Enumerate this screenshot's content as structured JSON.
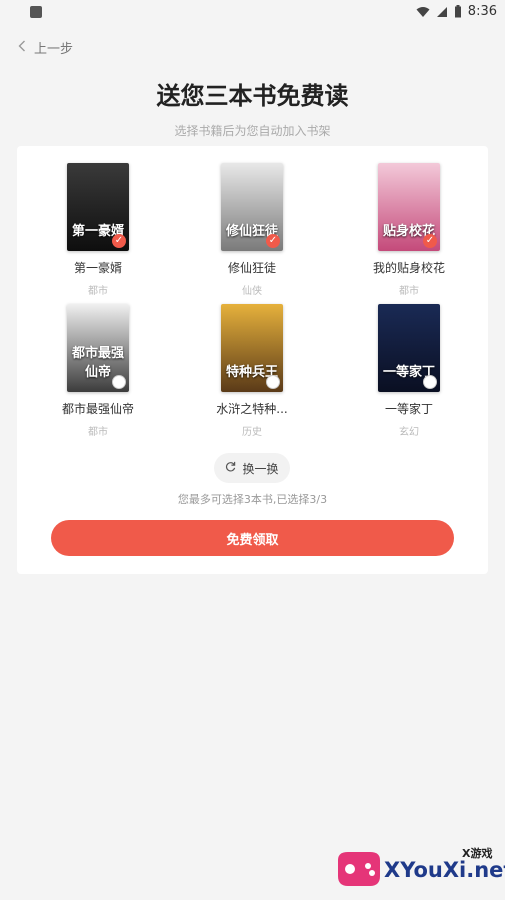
{
  "status_bar": {
    "time": "8:36"
  },
  "nav": {
    "back_label": "上一步"
  },
  "header": {
    "title": "送您三本书免费读",
    "subtitle": "选择书籍后为您自动加入书架"
  },
  "books": [
    {
      "name": "第一豪婿",
      "genre": "都市",
      "cover_text": "第一豪婿",
      "selected": true,
      "cover_colors": [
        "#3a3a3a",
        "#0e0e0e"
      ]
    },
    {
      "name": "修仙狂徒",
      "genre": "仙侠",
      "cover_text": "修仙狂徒",
      "selected": true,
      "cover_colors": [
        "#e8e8e8",
        "#7a7a7a"
      ]
    },
    {
      "name": "我的贴身校花",
      "genre": "都市",
      "cover_text": "贴身校花",
      "selected": true,
      "cover_colors": [
        "#f3c9d9",
        "#c44a7a"
      ]
    },
    {
      "name": "都市最强仙帝",
      "genre": "都市",
      "cover_text": "都市最强仙帝",
      "selected": false,
      "cover_colors": [
        "#f0f0f0",
        "#3c3c3c"
      ]
    },
    {
      "name": "水浒之特种...",
      "genre": "历史",
      "cover_text": "特种兵王",
      "selected": false,
      "cover_colors": [
        "#e6b13c",
        "#5a3a18"
      ]
    },
    {
      "name": "一等家丁",
      "genre": "玄幻",
      "cover_text": "一等家丁",
      "selected": false,
      "cover_colors": [
        "#1a2a55",
        "#0a0f22"
      ]
    }
  ],
  "actions": {
    "swap_label": "换一换",
    "hint": "您最多可选择3本书,已选择3/3",
    "claim_label": "免费领取"
  },
  "watermark": {
    "site": "XYouXi.net",
    "tag": "X游戏"
  },
  "colors": {
    "accent": "#f05a4a",
    "background": "#f4f4f4",
    "card": "#ffffff"
  }
}
